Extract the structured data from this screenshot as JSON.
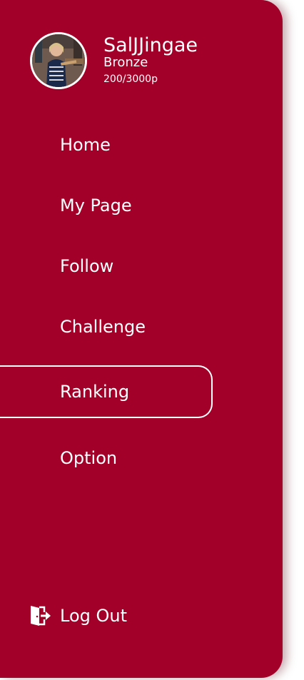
{
  "profile": {
    "username": "SalJJingae",
    "tier": "Bronze",
    "points": "200/3000p"
  },
  "menu": {
    "items": [
      {
        "label": "Home"
      },
      {
        "label": "My Page"
      },
      {
        "label": "Follow"
      },
      {
        "label": "Challenge"
      },
      {
        "label": "Ranking",
        "active": true
      },
      {
        "label": "Option"
      }
    ]
  },
  "logout": {
    "label": "Log Out",
    "icon": "logout-door-icon"
  },
  "colors": {
    "drawer_background": "#a30029",
    "text": "#ffffff",
    "active_outline": "#ffffff"
  }
}
